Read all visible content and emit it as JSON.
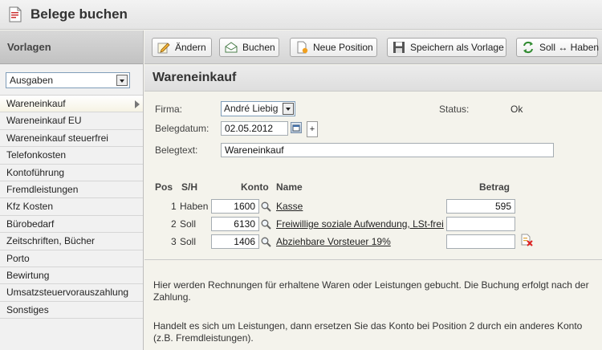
{
  "app": {
    "title": "Belege buchen"
  },
  "sidebar": {
    "heading": "Vorlagen",
    "category_select": "Ausgaben",
    "items": [
      "Wareneinkauf",
      "Wareneinkauf EU",
      "Wareneinkauf steuerfrei",
      "Telefonkosten",
      "Kontoführung",
      "Fremdleistungen",
      "Kfz Kosten",
      "Bürobedarf",
      "Zeitschriften, Bücher",
      "Porto",
      "Bewirtung",
      "Umsatzsteuervorauszahlung",
      "Sonstiges"
    ],
    "active_index": 0
  },
  "toolbar": {
    "edit": "Ändern",
    "book": "Buchen",
    "new_position": "Neue Position",
    "save_template": "Speichern als Vorlage",
    "swap": "Soll ↔ Haben"
  },
  "form": {
    "heading": "Wareneinkauf",
    "firma_label": "Firma:",
    "firma_value": "André Liebig",
    "status_label": "Status:",
    "status_value": "Ok",
    "date_label": "Belegdatum:",
    "date_value": "02.05.2012",
    "plus": "+",
    "text_label": "Belegtext:",
    "text_value": "Wareneinkauf"
  },
  "positions": {
    "headers": {
      "pos": "Pos",
      "sh": "S/H",
      "konto": "Konto",
      "name": "Name",
      "betrag": "Betrag"
    },
    "rows": [
      {
        "pos": "1",
        "sh": "Haben",
        "konto": "1600",
        "name": "Kasse",
        "betrag": "595"
      },
      {
        "pos": "2",
        "sh": "Soll",
        "konto": "6130",
        "name": "Freiwillige soziale Aufwendung, LSt-frei",
        "betrag": ""
      },
      {
        "pos": "3",
        "sh": "Soll",
        "konto": "1406",
        "name": "Abziehbare Vorsteuer 19%",
        "betrag": ""
      }
    ]
  },
  "info": {
    "p1": "Hier werden Rechnungen für erhaltene Waren oder Leistungen gebucht. Die Buchung erfolgt nach der Zahlung.",
    "p2": "Handelt es sich um Leistungen, dann ersetzen Sie das Konto bei Position 2 durch ein anderes Konto (z.B. Fremdleistungen)."
  },
  "colors": {
    "accent_green": "#2f8a2f",
    "delete_red": "#d22"
  }
}
